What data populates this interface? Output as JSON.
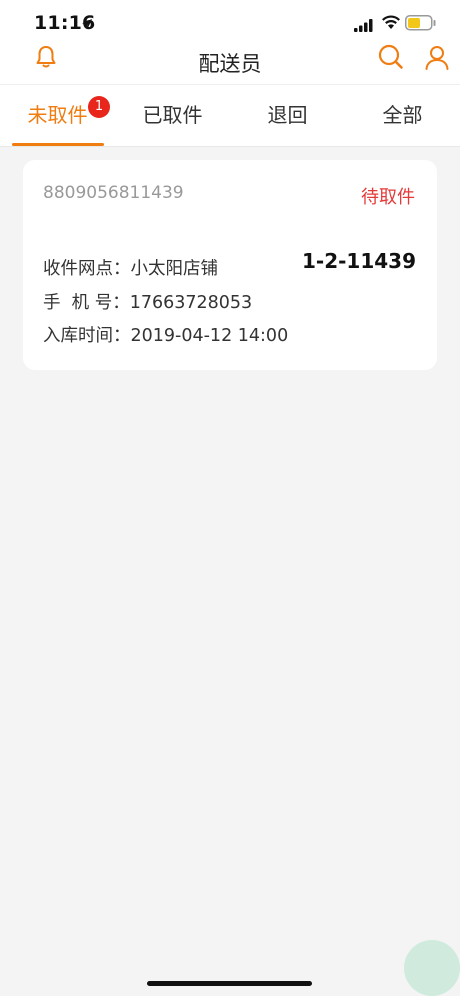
{
  "status_bar": {
    "time": "11:16"
  },
  "nav": {
    "title": "配送员"
  },
  "tabs": [
    {
      "label": "未取件",
      "badge": "1",
      "active": true
    },
    {
      "label": "已取件"
    },
    {
      "label": "退回"
    },
    {
      "label": "全部"
    }
  ],
  "card": {
    "tracking_number": "8809056811439",
    "status": "待取件",
    "code": "1-2-11439",
    "station_label": "收件网点：",
    "station_value": "小太阳店铺",
    "phone_label": "手  机 号：",
    "phone_value": "17663728053",
    "time_label": "入库时间：",
    "time_value": "2019-04-12 14:00"
  },
  "colors": {
    "accent": "#ef7d12",
    "status_red": "#e43a3a",
    "badge_red": "#e8261c"
  }
}
